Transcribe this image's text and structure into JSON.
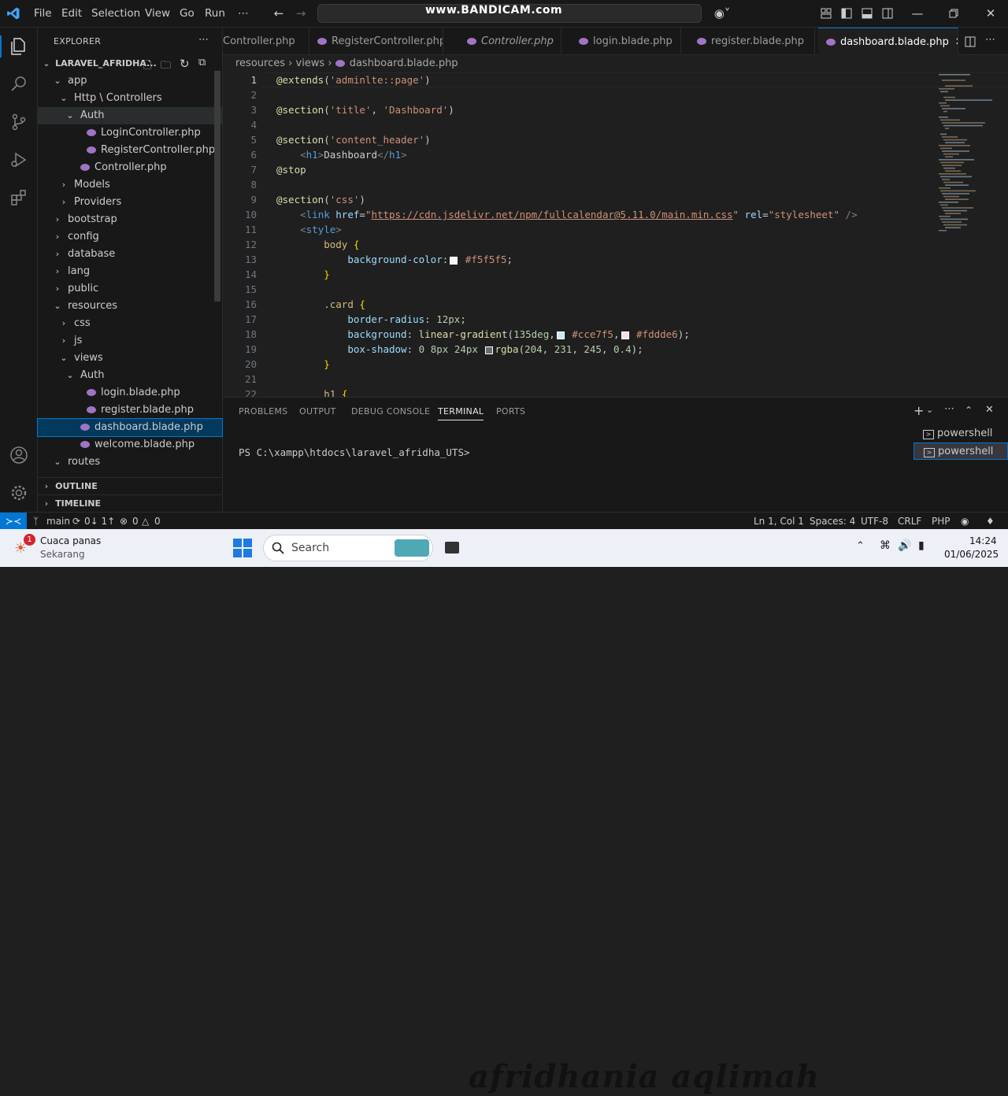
{
  "titlebar": {
    "menu": [
      "File",
      "Edit",
      "Selection",
      "View",
      "Go",
      "Run",
      "⋯"
    ],
    "watermark": "www.BANDICAM.com",
    "window_controls": [
      "minimize-icon",
      "restore-icon",
      "close-icon"
    ]
  },
  "explorer": {
    "title": "EXPLORER",
    "root": "LARAVEL_AFRIDHA...",
    "tree": [
      {
        "label": "app",
        "depth": 1,
        "type": "folder-open"
      },
      {
        "label": "Http \\ Controllers",
        "depth": 2,
        "type": "folder-open"
      },
      {
        "label": "Auth",
        "depth": 3,
        "type": "folder-open"
      },
      {
        "label": "LoginController.php",
        "depth": 4,
        "type": "php"
      },
      {
        "label": "RegisterController.php",
        "depth": 4,
        "type": "php"
      },
      {
        "label": "Controller.php",
        "depth": 3,
        "type": "php"
      },
      {
        "label": "Models",
        "depth": 2,
        "type": "folder"
      },
      {
        "label": "Providers",
        "depth": 2,
        "type": "folder"
      },
      {
        "label": "bootstrap",
        "depth": 1,
        "type": "folder"
      },
      {
        "label": "config",
        "depth": 1,
        "type": "folder"
      },
      {
        "label": "database",
        "depth": 1,
        "type": "folder"
      },
      {
        "label": "lang",
        "depth": 1,
        "type": "folder"
      },
      {
        "label": "public",
        "depth": 1,
        "type": "folder"
      },
      {
        "label": "resources",
        "depth": 1,
        "type": "folder-open"
      },
      {
        "label": "css",
        "depth": 2,
        "type": "folder"
      },
      {
        "label": "js",
        "depth": 2,
        "type": "folder"
      },
      {
        "label": "views",
        "depth": 2,
        "type": "folder-open"
      },
      {
        "label": "Auth",
        "depth": 3,
        "type": "folder-open"
      },
      {
        "label": "login.blade.php",
        "depth": 4,
        "type": "php"
      },
      {
        "label": "register.blade.php",
        "depth": 4,
        "type": "php"
      },
      {
        "label": "dashboard.blade.php",
        "depth": 3,
        "type": "php",
        "selected": true
      },
      {
        "label": "welcome.blade.php",
        "depth": 3,
        "type": "php"
      },
      {
        "label": "routes",
        "depth": 1,
        "type": "folder-open"
      }
    ],
    "outline": "OUTLINE",
    "timeline": "TIMELINE"
  },
  "tabs": [
    {
      "label": "Controller.php",
      "active": false
    },
    {
      "label": "RegisterController.php",
      "active": false
    },
    {
      "label": "Controller.php",
      "active": false
    },
    {
      "label": "login.blade.php",
      "active": false
    },
    {
      "label": "register.blade.php",
      "active": false
    },
    {
      "label": "dashboard.blade.php",
      "active": true
    }
  ],
  "breadcrumb": [
    "resources",
    "views",
    "dashboard.blade.php"
  ],
  "editor": {
    "line_numbers": [
      "1",
      "2",
      "3",
      "4",
      "5",
      "6",
      "7",
      "8",
      "9",
      "10",
      "11",
      "12",
      "13",
      "14",
      "15",
      "16",
      "17",
      "18",
      "19",
      "20",
      "21",
      "22"
    ],
    "colors": {
      "f5": "#f5f5f5",
      "cce7f5": "#cce7f5",
      "fddde6": "#fddde6",
      "shadow": "rgba(204, 231, 245, 0.4)"
    }
  },
  "panel": {
    "tabs": [
      "PROBLEMS",
      "OUTPUT",
      "DEBUG CONSOLE",
      "TERMINAL",
      "PORTS"
    ],
    "active_tab": "TERMINAL",
    "prompt": "PS C:\\xampp\\htdocs\\laravel_afridha_UTS>",
    "shells": [
      "powershell",
      "powershell"
    ]
  },
  "statusbar": {
    "branch": "main",
    "sync": "0↓ 1↑",
    "errors": "0",
    "warnings": "0",
    "position": "Ln 1, Col 1",
    "spaces": "Spaces: 4",
    "encoding": "UTF-8",
    "eol": "CRLF",
    "language": "PHP"
  },
  "taskbar": {
    "weather_badge": "1",
    "weather_title": "Cuaca panas",
    "weather_sub": "Sekarang",
    "search_placeholder": "Search",
    "time": "14:24",
    "date": "01/06/2025",
    "overlay_text": "afridhania aqlimah"
  }
}
